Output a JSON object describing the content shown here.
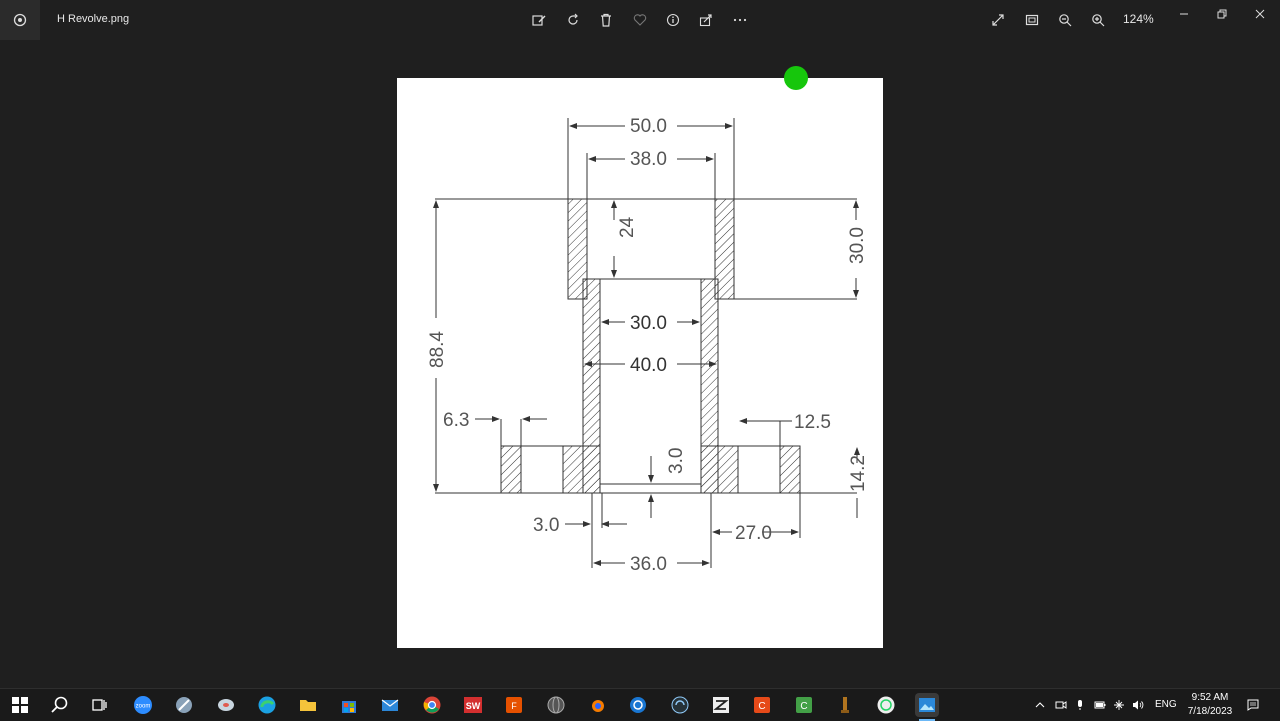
{
  "window": {
    "file_name": "H Revolve.png",
    "zoom": "124%",
    "toolbar": [
      "edit-image-icon",
      "rotate-icon",
      "delete-icon",
      "favorite-icon",
      "info-icon",
      "share-icon",
      "more-icon"
    ],
    "right_tools": [
      "fullscreen-icon",
      "fit-to-window-icon",
      "zoom-out-icon",
      "zoom-in-icon"
    ]
  },
  "drawing": {
    "dims": {
      "top_outer": "50.0",
      "top_inner": "38.0",
      "cup_depth": "24",
      "cup_height": "30.0",
      "total_height": "88.4",
      "neck_inner": "30.0",
      "neck_outer": "40.0",
      "left_small": "6.3",
      "right_small": "12.5",
      "base_thickness": "3.0",
      "base_height": "14.2",
      "bottom_left": "3.0",
      "bottom_right": "27.0",
      "bottom_width": "36.0"
    }
  },
  "taskbar": {
    "apps": [
      "windows-start",
      "search",
      "task-view",
      "zoom",
      "app-feather",
      "app-disk",
      "edge",
      "file-explorer",
      "store",
      "mail",
      "chrome",
      "solidworks",
      "foxit",
      "app-sphere",
      "blender",
      "app-target",
      "app-davinci",
      "app-zbrush",
      "app-red",
      "app-green",
      "app-torch",
      "whatsapp",
      "photos"
    ],
    "language": "ENG",
    "time": "9:52 AM",
    "date": "7/18/2023"
  }
}
